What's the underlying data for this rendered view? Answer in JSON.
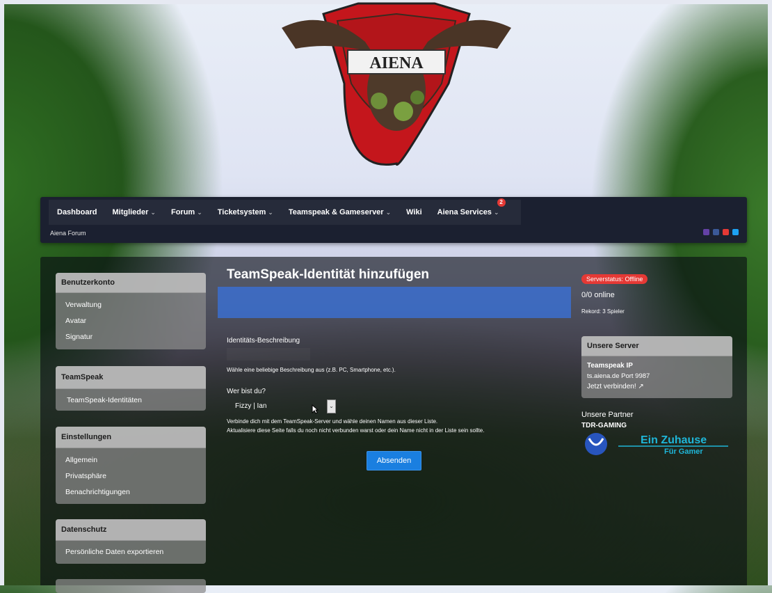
{
  "logo": {
    "text": "AIENA"
  },
  "nav": {
    "items": [
      {
        "label": "Dashboard",
        "dropdown": false
      },
      {
        "label": "Mitglieder",
        "dropdown": true
      },
      {
        "label": "Forum",
        "dropdown": true
      },
      {
        "label": "Ticketsystem",
        "dropdown": true
      },
      {
        "label": "Teamspeak & Gameserver",
        "dropdown": true
      },
      {
        "label": "Wiki",
        "dropdown": false
      },
      {
        "label": "Aiena Services",
        "dropdown": true
      }
    ],
    "services_badge": "2",
    "breadcrumb": "Aiena Forum",
    "social_colors": [
      "#6441a5",
      "#3b5998",
      "#e53935",
      "#1da1f2"
    ]
  },
  "sidebar": {
    "account": {
      "title": "Benutzerkonto",
      "items": [
        "Verwaltung",
        "Avatar",
        "Signatur"
      ]
    },
    "teamspeak": {
      "title": "TeamSpeak",
      "items": [
        "TeamSpeak-Identitäten"
      ]
    },
    "settings": {
      "title": "Einstellungen",
      "items": [
        "Allgemein",
        "Privatsphäre",
        "Benachrichtigungen"
      ]
    },
    "privacy": {
      "title": "Datenschutz",
      "items": [
        "Persönliche Daten exportieren"
      ]
    }
  },
  "content": {
    "title": "TeamSpeak-Identität hinzufügen",
    "desc_label": "Identitäts-Beschreibung",
    "desc_value": "",
    "desc_hint": "Wähle eine beliebige Beschreibung aus (z.B. PC, Smartphone, etc.).",
    "who_label": "Wer bist du?",
    "who_value": "Fizzy | Ian",
    "help_line1": "Verbinde dich mit dem TeamSpeak-Server und wähle deinen Namen aus dieser Liste.",
    "help_line2": "Aktualisiere diese Seite falls du noch nicht verbunden warst oder dein Name nicht in der Liste sein sollte.",
    "submit": "Absenden"
  },
  "right": {
    "server_status": "Serverstatus: Offline",
    "online": "0/0 online",
    "record": "Rekord: 3 Spieler",
    "servers_title": "Unsere Server",
    "ts_label": "Teamspeak IP",
    "ts_address": "ts.aiena.de Port 9987",
    "connect": "Jetzt verbinden!",
    "partners_title": "Unsere Partner",
    "partner_name": "TDR-GAMING",
    "partner_slogan1": "Ein Zuhause",
    "partner_slogan2": "Für Gamer"
  }
}
